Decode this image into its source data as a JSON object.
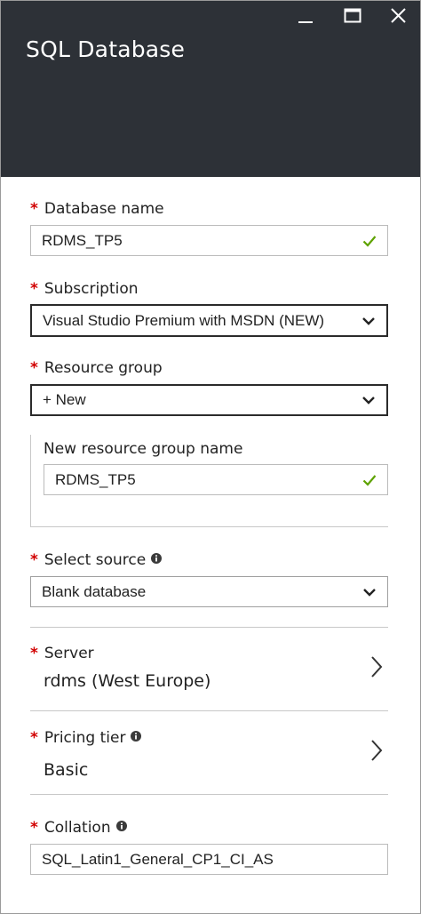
{
  "window": {
    "title": "SQL Database",
    "controls": [
      "minimize-icon",
      "maximize-icon",
      "close-icon"
    ]
  },
  "form": {
    "database_name": {
      "label": "Database name",
      "required": true,
      "value": "RDMS_TP5",
      "valid": true
    },
    "subscription": {
      "label": "Subscription",
      "required": true,
      "value": "Visual Studio Premium with MSDN (NEW)"
    },
    "resource_group": {
      "label": "Resource group",
      "required": true,
      "value": "+ New"
    },
    "new_resource_group": {
      "label": "New resource group name",
      "value": "RDMS_TP5",
      "valid": true
    },
    "select_source": {
      "label": "Select source",
      "required": true,
      "value": "Blank database",
      "has_info": true
    },
    "server": {
      "label": "Server",
      "required": true,
      "value": "rdms (West Europe)"
    },
    "pricing_tier": {
      "label": "Pricing tier",
      "required": true,
      "value": "Basic",
      "has_info": true
    },
    "collation": {
      "label": "Collation",
      "required": true,
      "value": "SQL_Latin1_General_CP1_CI_AS",
      "has_info": true
    }
  },
  "required_marker": "*",
  "colors": {
    "header_bg": "#2d3137",
    "required": "#d10000",
    "valid_check": "#5ea200"
  }
}
